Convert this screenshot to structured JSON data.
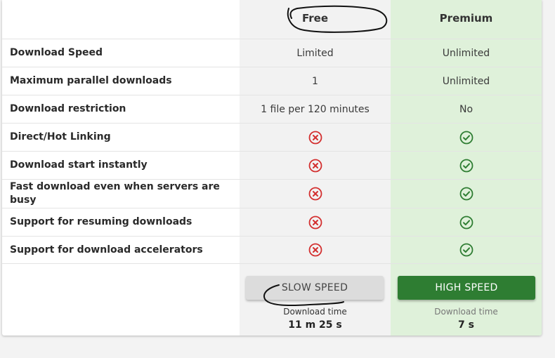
{
  "plans": {
    "free": {
      "title": "Free"
    },
    "premium": {
      "title": "Premium"
    }
  },
  "features": [
    {
      "label": "Download Speed",
      "free": "Limited",
      "premium": "Unlimited"
    },
    {
      "label": "Maximum parallel downloads",
      "free": "1",
      "premium": "Unlimited"
    },
    {
      "label": "Download restriction",
      "free": "1 file per 120 minutes",
      "premium": "No"
    },
    {
      "label": "Direct/Hot Linking",
      "free_icon": "x-circle-icon",
      "premium_icon": "check-circle-icon"
    },
    {
      "label": "Download start instantly",
      "free_icon": "x-circle-icon",
      "premium_icon": "check-circle-icon"
    },
    {
      "label": "Fast download even when servers are busy",
      "free_icon": "x-circle-icon",
      "premium_icon": "check-circle-icon"
    },
    {
      "label": "Support for resuming downloads",
      "free_icon": "x-circle-icon",
      "premium_icon": "check-circle-icon"
    },
    {
      "label": "Support for download accelerators",
      "free_icon": "x-circle-icon",
      "premium_icon": "check-circle-icon"
    }
  ],
  "footer": {
    "free": {
      "button": "SLOW SPEED",
      "time_label": "Download time",
      "time_value": "11 m 25 s"
    },
    "premium": {
      "button": "HIGH SPEED",
      "time_label": "Download time",
      "time_value": "7 s"
    }
  },
  "colors": {
    "free_column": "#f2f2f2",
    "premium_column": "#dff1da",
    "high_speed_button": "#2e7d32",
    "x_icon": "#d32f2f",
    "check_icon": "#2e7d32"
  }
}
